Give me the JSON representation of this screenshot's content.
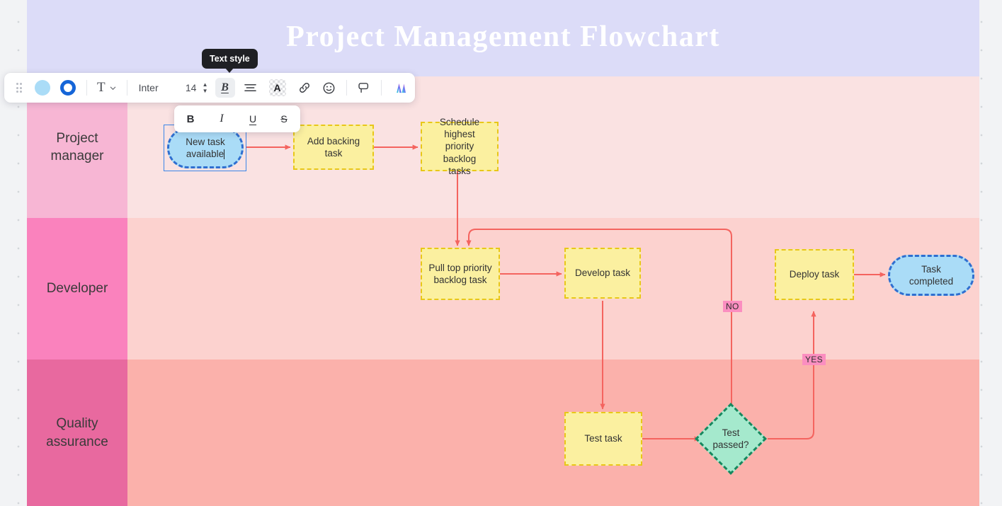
{
  "board": {
    "title": "Project Management Flowchart",
    "lanes": [
      {
        "label": "Project\nmanager",
        "label_line1": "Project",
        "label_line2": "manager"
      },
      {
        "label": "Developer",
        "label_line1": "Developer",
        "label_line2": ""
      },
      {
        "label": "Quality assurance",
        "label_line1": "Quality",
        "label_line2": "assurance"
      }
    ]
  },
  "nodes": {
    "new_task": {
      "label_line1": "New task",
      "label_line2": "available",
      "shape": "rounded",
      "color": "#aadcf7",
      "selected": true
    },
    "add_backing": {
      "label": "Add backing task",
      "shape": "rect",
      "color": "#fbf0a0"
    },
    "schedule": {
      "label_line1": "Schedule highest",
      "label_line2": "priority backlog",
      "label_line3": "tasks",
      "shape": "rect",
      "color": "#fbf0a0"
    },
    "pull_top": {
      "label_line1": "Pull top priority",
      "label_line2": "backlog task",
      "shape": "rect",
      "color": "#fbf0a0"
    },
    "develop": {
      "label": "Develop task",
      "shape": "rect",
      "color": "#fbf0a0"
    },
    "deploy": {
      "label": "Deploy task",
      "shape": "rect",
      "color": "#fbf0a0"
    },
    "completed": {
      "label_line1": "Task",
      "label_line2": "completed",
      "shape": "rounded",
      "color": "#aadcf7"
    },
    "test_task": {
      "label": "Test task",
      "shape": "rect",
      "color": "#fbf0a0"
    },
    "test_passed": {
      "label_line1": "Test",
      "label_line2": "passed?",
      "shape": "diamond",
      "color": "#a5e9cd"
    }
  },
  "edge_labels": {
    "no": "NO",
    "yes": "YES"
  },
  "toolbar": {
    "fill_swatch": "#aadcf7",
    "stroke_swatch": "#1565d8",
    "text_type_label": "T",
    "font_family": "Inter",
    "font_size": "14",
    "bold_label": "B",
    "tooltip": "Text style"
  },
  "submenu": {
    "bold": "B",
    "italic": "I",
    "underline": "U",
    "strikethrough": "S"
  },
  "colors": {
    "accent_blue": "#2f6fd0",
    "arrow_red": "#f4645f",
    "lane1_header": "#f7b6d4",
    "lane2_header": "#fa82bd",
    "lane3_header": "#e8699f",
    "title_band": "#dcdcf8",
    "yellow_node": "#fbf0a0",
    "yellow_border": "#e8c718",
    "green_node": "#a5e9cd",
    "green_border": "#17875e",
    "label_pink": "#fb8ec0"
  }
}
